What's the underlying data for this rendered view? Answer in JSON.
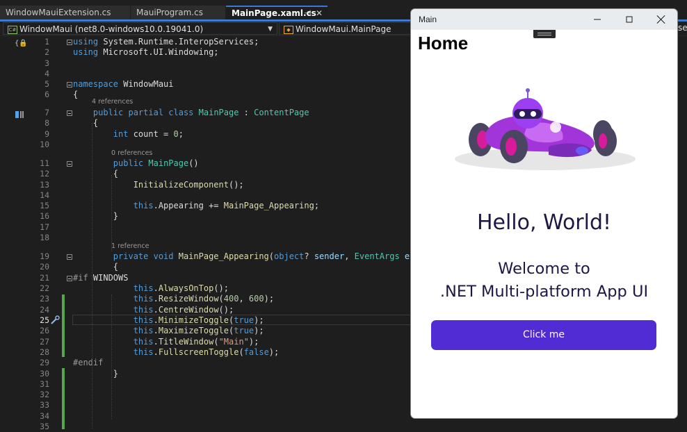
{
  "ide": {
    "tabs": [
      {
        "label": "WindowMauiExtension.cs"
      },
      {
        "label": "MauiProgram.cs"
      },
      {
        "label": "MainPage.xaml.cs",
        "pin": "⊣",
        "close": "✕"
      }
    ],
    "nav": {
      "project": "WindowMaui (net8.0-windows10.0.19041.0)",
      "type": "WindowMaui.MainPage",
      "trailing": "se"
    },
    "code": {
      "lines": [
        {
          "n": "1",
          "html": "<span class='kw'>using</span> System.Runtime.InteropServices;"
        },
        {
          "n": "2",
          "html": "<span class='kw'>using</span> Microsoft.UI.Windowing;"
        },
        {
          "n": "3",
          "html": ""
        },
        {
          "n": "4",
          "html": ""
        },
        {
          "n": "5",
          "html": "<span class='kw'>namespace</span> WindowMaui"
        },
        {
          "n": "6",
          "html": "{"
        },
        {
          "n": "7",
          "html": "    <span class='kw'>public partial class</span> <span class='ty'>MainPage</span> : <span class='ty'>ContentPage</span>"
        },
        {
          "n": "8",
          "html": "    {"
        },
        {
          "n": "9",
          "html": "        <span class='kw'>int</span> count = <span class='nu'>0</span>;"
        },
        {
          "n": "10",
          "html": ""
        },
        {
          "n": "11",
          "html": "        <span class='kw'>public</span> <span class='ty'>MainPage</span>()"
        },
        {
          "n": "12",
          "html": "        {"
        },
        {
          "n": "13",
          "html": "            <span class='fn'>InitializeComponent</span>();"
        },
        {
          "n": "14",
          "html": ""
        },
        {
          "n": "15",
          "html": "            <span class='kw'>this</span>.Appearing += <span class='fn'>MainPage_Appearing</span>;"
        },
        {
          "n": "16",
          "html": "        }"
        },
        {
          "n": "17",
          "html": ""
        },
        {
          "n": "18",
          "html": ""
        },
        {
          "n": "19",
          "html": "        <span class='kw'>private void</span> <span class='fn'>MainPage_Appearing</span>(<span class='kw'>object</span>? <span class='pa'>sender</span>, <span class='ty'>EventArgs</span> <span class='pa'>e</span>)"
        },
        {
          "n": "20",
          "html": "        {"
        },
        {
          "n": "21",
          "html": "<span class='pp'>#if</span> WINDOWS"
        },
        {
          "n": "22",
          "html": "            <span class='kw'>this</span>.<span class='fn'>AlwaysOnTop</span>();"
        },
        {
          "n": "23",
          "html": "            <span class='kw'>this</span>.<span class='fn'>ResizeWindow</span>(<span class='nu'>400</span>, <span class='nu'>600</span>);"
        },
        {
          "n": "24",
          "html": "            <span class='kw'>this</span>.<span class='fn'>CentreWindow</span>();"
        },
        {
          "n": "25",
          "html": "            <span class='kw'>this</span>.<span class='fn'>MinimizeToggle</span>(<span class='kw'>true</span>);"
        },
        {
          "n": "26",
          "html": "            <span class='kw'>this</span>.<span class='fn'>MaximizeToggle</span>(<span class='kw'>true</span>);"
        },
        {
          "n": "27",
          "html": "            <span class='kw'>this</span>.<span class='fn'>TitleWindow</span>(<span class='st'>\"Main\"</span>);"
        },
        {
          "n": "28",
          "html": "            <span class='kw'>this</span>.<span class='fn'>FullscreenToggle</span>(<span class='kw'>false</span>);"
        },
        {
          "n": "29",
          "html": "<span class='pp'>#endif</span>"
        },
        {
          "n": "30",
          "html": "        }"
        },
        {
          "n": "31",
          "html": ""
        },
        {
          "n": "32",
          "html": ""
        },
        {
          "n": "33",
          "html": ""
        },
        {
          "n": "34",
          "html": ""
        },
        {
          "n": "35",
          "html": ""
        }
      ],
      "codelens": [
        {
          "text": "4 references",
          "before_line": "7"
        },
        {
          "text": "0 references",
          "before_line": "11"
        },
        {
          "text": "1 reference",
          "before_line": "19"
        }
      ],
      "current_line": "25"
    }
  },
  "app": {
    "window_title": "Main",
    "page_title": "Home",
    "hello": "Hello, World!",
    "welcome_line1": "Welcome to",
    "welcome_line2": ".NET Multi-platform App UI",
    "button": "Click me",
    "accent": "#512bd4",
    "image_icon": "dotnet-bot-race-car"
  }
}
